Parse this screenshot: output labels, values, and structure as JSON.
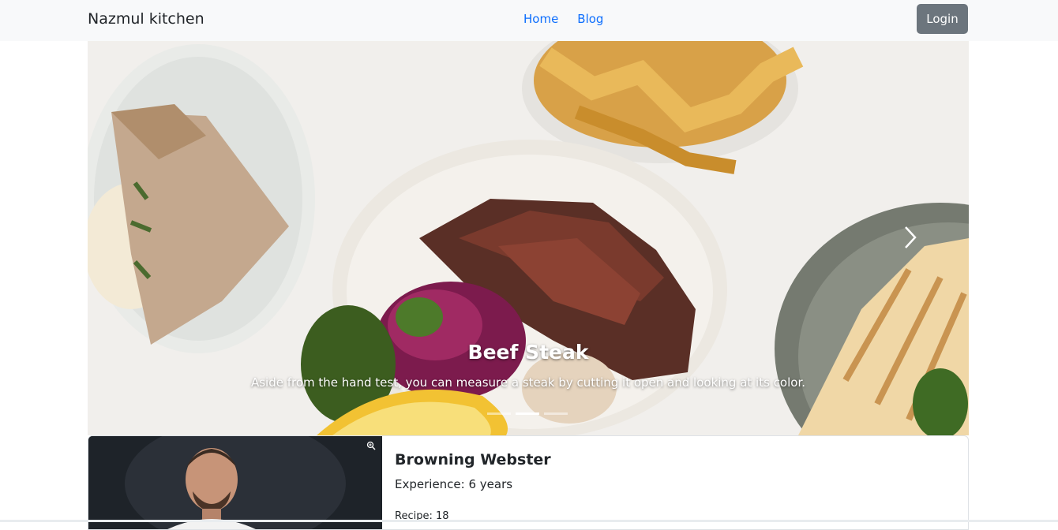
{
  "navbar": {
    "brand": "Nazmul kitchen",
    "links": [
      {
        "label": "Home"
      },
      {
        "label": "Blog"
      }
    ],
    "login_label": "Login"
  },
  "carousel": {
    "caption_title": "Beef Steak",
    "caption_text": "Aside from the hand test, you can measure a steak by cutting it open and looking at its color.",
    "slide_count": 3,
    "active_slide": 2
  },
  "chef": {
    "name": "Browning Webster",
    "experience": "Experience: 6 years",
    "recipes": "Recipe: 18"
  },
  "colors": {
    "navbar_bg": "#f8f9fa",
    "link": "#0d6efd",
    "button": "#6c757d"
  }
}
